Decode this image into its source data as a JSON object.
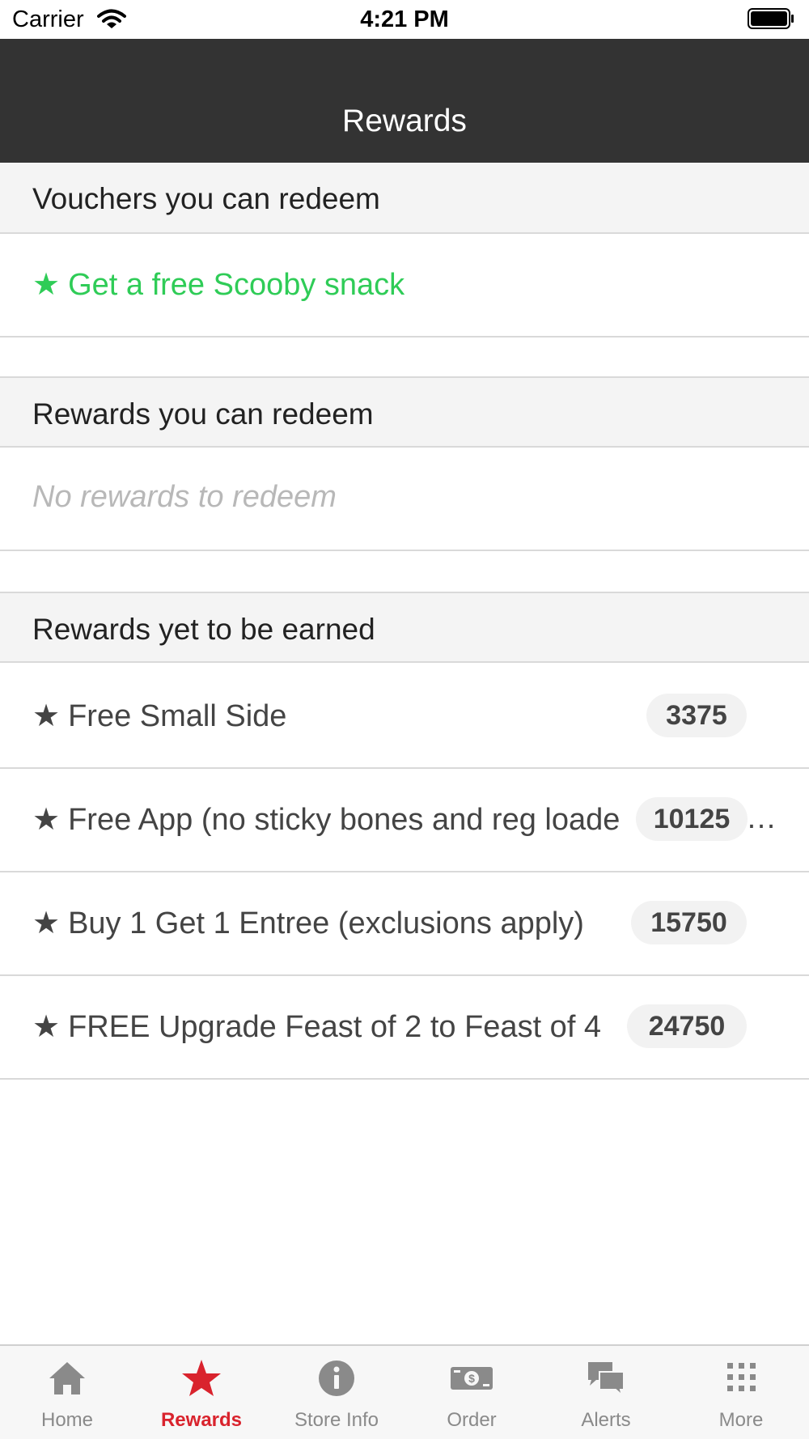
{
  "status_bar": {
    "carrier": "Carrier",
    "time": "4:21 PM"
  },
  "nav": {
    "title": "Rewards"
  },
  "sections": {
    "vouchers": {
      "header": "Vouchers you can redeem",
      "items": [
        {
          "star": "★",
          "label": "Get a free Scooby snack"
        }
      ]
    },
    "redeemable": {
      "header": "Rewards you can redeem",
      "empty_text": "No rewards to redeem"
    },
    "to_earn": {
      "header": "Rewards yet to be earned",
      "items": [
        {
          "star": "★",
          "label": "Free Small Side",
          "points": "3375"
        },
        {
          "star": "★",
          "label": "Free App (no sticky bones and reg loade",
          "points": "10125",
          "overflow": "…"
        },
        {
          "star": "★",
          "label": "Buy 1 Get 1 Entree (exclusions apply)",
          "points": "15750"
        },
        {
          "star": "★",
          "label": "FREE Upgrade Feast of 2 to Feast of 4",
          "points": "24750"
        }
      ]
    }
  },
  "tabs": [
    {
      "label": "Home",
      "icon": "home-icon"
    },
    {
      "label": "Rewards",
      "icon": "star-icon",
      "active": true
    },
    {
      "label": "Store Info",
      "icon": "info-icon"
    },
    {
      "label": "Order",
      "icon": "money-icon"
    },
    {
      "label": "Alerts",
      "icon": "chat-bubbles-icon"
    },
    {
      "label": "More",
      "icon": "grid-dots-icon"
    }
  ],
  "colors": {
    "nav_bg": "#333333",
    "voucher_green": "#2fcc57",
    "active_tab_red": "#d9232d",
    "inactive_tab_gray": "#8a8a8a"
  }
}
